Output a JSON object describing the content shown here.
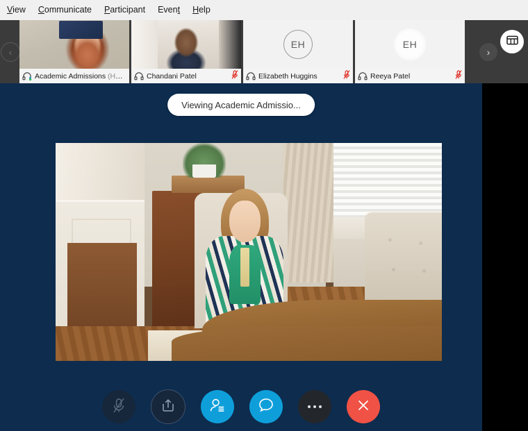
{
  "menu": {
    "items": [
      {
        "pre": "",
        "acc": "V",
        "post": "iew"
      },
      {
        "pre": "",
        "acc": "C",
        "post": "ommunicate"
      },
      {
        "pre": "",
        "acc": "P",
        "post": "articipant"
      },
      {
        "pre": "Even",
        "acc": "t",
        "post": ""
      },
      {
        "pre": "",
        "acc": "H",
        "post": "elp"
      }
    ]
  },
  "filmstrip": {
    "prev_label": "‹",
    "next_label": "›",
    "layout_icon": "layout-view-icon",
    "participants": [
      {
        "name": "Academic Admissions",
        "role": "(Host)",
        "active": true,
        "video": true,
        "muted": false,
        "audio_icon": "headset-icon",
        "initials": ""
      },
      {
        "name": "Chandani Patel",
        "role": "",
        "active": false,
        "video": true,
        "muted": true,
        "audio_icon": "headset-icon",
        "initials": ""
      },
      {
        "name": "Elizabeth Huggins",
        "role": "",
        "active": false,
        "video": false,
        "muted": true,
        "audio_icon": "headset-icon",
        "initials": "EH"
      },
      {
        "name": "Reeya Patel",
        "role": "",
        "active": false,
        "video": false,
        "muted": true,
        "audio_icon": "headset-icon",
        "initials": "EH"
      }
    ]
  },
  "stage": {
    "viewing_label": "Viewing Academic Admissio...",
    "background_color": "#0d2c4e"
  },
  "controls": {
    "buttons": [
      {
        "name": "mute-button",
        "icon": "microphone-muted-icon",
        "style": "dark",
        "label": ""
      },
      {
        "name": "share-button",
        "icon": "share-content-icon",
        "style": "dark-outline",
        "label": ""
      },
      {
        "name": "participants-button",
        "icon": "participants-icon",
        "style": "blue",
        "label": ""
      },
      {
        "name": "chat-button",
        "icon": "chat-bubble-icon",
        "style": "blue",
        "label": ""
      },
      {
        "name": "more-options-button",
        "icon": "more-ellipsis-icon",
        "style": "grey",
        "label": ""
      },
      {
        "name": "leave-meeting-button",
        "icon": "close-x-icon",
        "style": "red",
        "label": ""
      }
    ],
    "accent_blue": "#0e9fdb",
    "leave_red": "#f05245"
  }
}
